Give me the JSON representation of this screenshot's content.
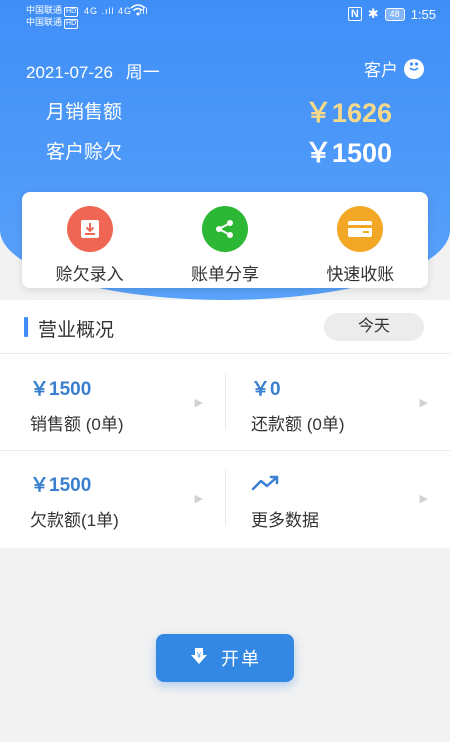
{
  "status_bar": {
    "carrier1": "中国联通",
    "carrier2": "中国联通",
    "hd": "HD",
    "signal": "4G .ıll 4G .ıll",
    "nfc": "N",
    "battery": "48",
    "time": "1:55"
  },
  "header": {
    "date": "2021-07-26",
    "weekday": "周一",
    "customer_label": "客户"
  },
  "stats": {
    "sales_label": "月销售额",
    "sales_value": "￥1626",
    "debt_label": "客户赊欠",
    "debt_value": "￥1500"
  },
  "actions": [
    {
      "label": "赊欠录入",
      "icon": "credit-entry-icon",
      "color": "#ef6754"
    },
    {
      "label": "账单分享",
      "icon": "share-icon",
      "color": "#2cb734"
    },
    {
      "label": "快速收账",
      "icon": "card-icon",
      "color": "#f2a824"
    }
  ],
  "overview": {
    "title": "营业概况",
    "period": "今天",
    "cells": [
      {
        "amount": "￥1500",
        "label": "销售额 (0单)"
      },
      {
        "amount": "￥0",
        "label": "还款额 (0单)"
      },
      {
        "amount": "￥1500",
        "label": "欠款额(1单)"
      },
      {
        "label": "更多数据",
        "icon": "trend-up-icon"
      }
    ]
  },
  "open_order_button": {
    "label": "开单",
    "icon": "download-yen-icon"
  },
  "colors": {
    "primary": "#3f8ef8",
    "accent_gold": "#f6d98b",
    "amount_blue": "#3a7fd0"
  }
}
